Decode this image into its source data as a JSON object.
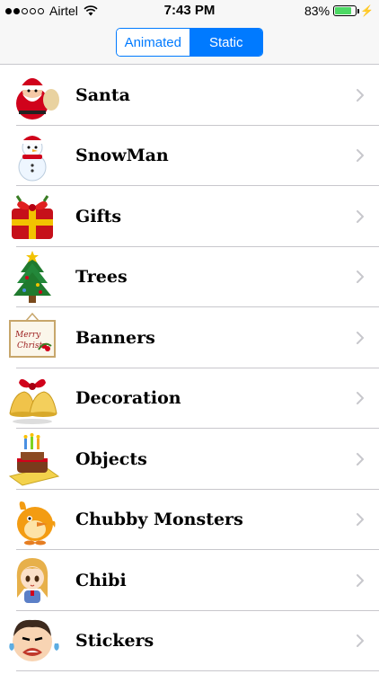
{
  "status_bar": {
    "carrier": "Airtel",
    "time": "7:43 PM",
    "battery_percent": "83%",
    "battery_level": 0.83,
    "signal_bars_filled": 2,
    "signal_bars_total": 5
  },
  "segmented_control": {
    "options": [
      "Animated",
      "Static"
    ],
    "selected": "Static"
  },
  "categories": [
    {
      "label": "Santa",
      "icon": "santa-icon"
    },
    {
      "label": "SnowMan",
      "icon": "snowman-icon"
    },
    {
      "label": "Gifts",
      "icon": "gift-icon"
    },
    {
      "label": "Trees",
      "icon": "christmas-tree-icon"
    },
    {
      "label": "Banners",
      "icon": "merry-christmas-banner-icon"
    },
    {
      "label": "Decoration",
      "icon": "bells-icon"
    },
    {
      "label": "Objects",
      "icon": "cake-icon"
    },
    {
      "label": "Chubby Monsters",
      "icon": "chubby-monster-icon"
    },
    {
      "label": "Chibi",
      "icon": "chibi-girl-icon"
    },
    {
      "label": "Stickers",
      "icon": "crying-face-icon"
    }
  ],
  "colors": {
    "accent": "#007aff",
    "battery": "#4cd964",
    "separator": "#c8c7cc"
  }
}
